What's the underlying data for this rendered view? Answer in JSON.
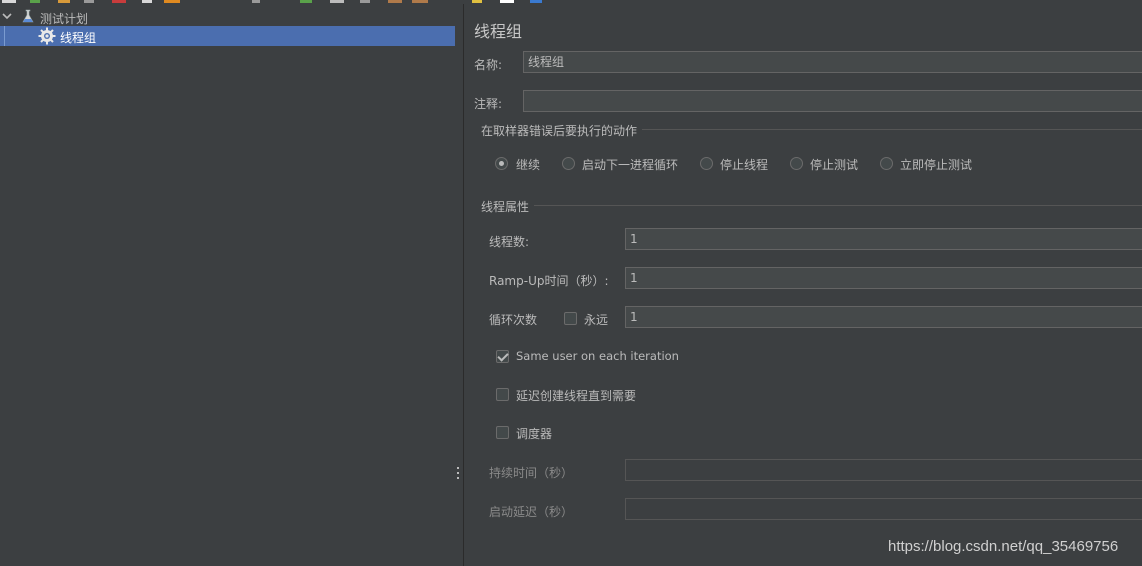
{
  "tree": {
    "root_label": "测试计划",
    "child_label": "线程组"
  },
  "panel": {
    "title": "线程组",
    "name_label": "名称:",
    "name_value": "线程组",
    "comment_label": "注释:",
    "comment_value": "",
    "error_action_group": "在取样器错误后要执行的动作",
    "error_actions": [
      {
        "label": "继续",
        "selected": true
      },
      {
        "label": "启动下一进程循环",
        "selected": false
      },
      {
        "label": "停止线程",
        "selected": false
      },
      {
        "label": "停止测试",
        "selected": false
      },
      {
        "label": "立即停止测试",
        "selected": false
      }
    ],
    "thread_props_group": "线程属性",
    "threads_label": "线程数:",
    "threads_value": "1",
    "rampup_label": "Ramp-Up时间（秒）:",
    "rampup_value": "1",
    "loop_label": "循环次数",
    "forever_label": "永远",
    "forever_checked": false,
    "loop_value": "1",
    "same_user_label": "Same user on each iteration",
    "same_user_checked": true,
    "delay_create_label": "延迟创建线程直到需要",
    "delay_create_checked": false,
    "scheduler_label": "调度器",
    "scheduler_checked": false,
    "duration_label": "持续时间（秒）",
    "duration_value": "",
    "startup_delay_label": "启动延迟（秒）",
    "startup_delay_value": ""
  },
  "watermark": "https://blog.csdn.net/qq_35469756",
  "colors": {
    "background": "#3c3f41",
    "selection": "#4b6eaf",
    "field": "#45494a",
    "text": "#bbbbbb"
  },
  "icons": [
    "expander-chevron-icon",
    "test-plan-flask-icon",
    "thread-group-gear-icon"
  ]
}
